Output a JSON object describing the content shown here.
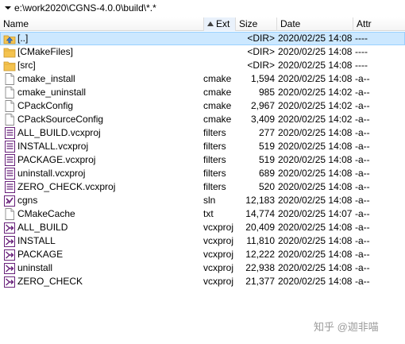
{
  "path_bar": {
    "path": "e:\\work2020\\CGNS-4.0.0\\build\\*.*",
    "dropdown_icon": "chevron-down-icon"
  },
  "columns": {
    "name": "Name",
    "ext": "Ext",
    "size": "Size",
    "date": "Date",
    "attr": "Attr",
    "sort_indicator": "sort-ascending-icon"
  },
  "rows": [
    {
      "name": "[..]",
      "ext": "",
      "size": "<DIR>",
      "date": "2020/02/25 14:08",
      "attr": "----",
      "icon": "up-dir"
    },
    {
      "name": "[CMakeFiles]",
      "ext": "",
      "size": "<DIR>",
      "date": "2020/02/25 14:08",
      "attr": "----",
      "icon": "folder"
    },
    {
      "name": "[src]",
      "ext": "",
      "size": "<DIR>",
      "date": "2020/02/25 14:08",
      "attr": "----",
      "icon": "folder"
    },
    {
      "name": "cmake_install",
      "ext": "cmake",
      "size": "1,594",
      "date": "2020/02/25 14:08",
      "attr": "-a--",
      "icon": "file"
    },
    {
      "name": "cmake_uninstall",
      "ext": "cmake",
      "size": "985",
      "date": "2020/02/25 14:02",
      "attr": "-a--",
      "icon": "file"
    },
    {
      "name": "CPackConfig",
      "ext": "cmake",
      "size": "2,967",
      "date": "2020/02/25 14:02",
      "attr": "-a--",
      "icon": "file"
    },
    {
      "name": "CPackSourceConfig",
      "ext": "cmake",
      "size": "3,409",
      "date": "2020/02/25 14:02",
      "attr": "-a--",
      "icon": "file"
    },
    {
      "name": "ALL_BUILD.vcxproj",
      "ext": "filters",
      "size": "277",
      "date": "2020/02/25 14:08",
      "attr": "-a--",
      "icon": "filters"
    },
    {
      "name": "INSTALL.vcxproj",
      "ext": "filters",
      "size": "519",
      "date": "2020/02/25 14:08",
      "attr": "-a--",
      "icon": "filters"
    },
    {
      "name": "PACKAGE.vcxproj",
      "ext": "filters",
      "size": "519",
      "date": "2020/02/25 14:08",
      "attr": "-a--",
      "icon": "filters"
    },
    {
      "name": "uninstall.vcxproj",
      "ext": "filters",
      "size": "689",
      "date": "2020/02/25 14:08",
      "attr": "-a--",
      "icon": "filters"
    },
    {
      "name": "ZERO_CHECK.vcxproj",
      "ext": "filters",
      "size": "520",
      "date": "2020/02/25 14:08",
      "attr": "-a--",
      "icon": "filters"
    },
    {
      "name": "cgns",
      "ext": "sln",
      "size": "12,183",
      "date": "2020/02/25 14:08",
      "attr": "-a--",
      "icon": "sln"
    },
    {
      "name": "CMakeCache",
      "ext": "txt",
      "size": "14,774",
      "date": "2020/02/25 14:07",
      "attr": "-a--",
      "icon": "file"
    },
    {
      "name": "ALL_BUILD",
      "ext": "vcxproj",
      "size": "20,409",
      "date": "2020/02/25 14:08",
      "attr": "-a--",
      "icon": "vcxproj"
    },
    {
      "name": "INSTALL",
      "ext": "vcxproj",
      "size": "11,810",
      "date": "2020/02/25 14:08",
      "attr": "-a--",
      "icon": "vcxproj"
    },
    {
      "name": "PACKAGE",
      "ext": "vcxproj",
      "size": "12,222",
      "date": "2020/02/25 14:08",
      "attr": "-a--",
      "icon": "vcxproj"
    },
    {
      "name": "uninstall",
      "ext": "vcxproj",
      "size": "22,938",
      "date": "2020/02/25 14:08",
      "attr": "-a--",
      "icon": "vcxproj"
    },
    {
      "name": "ZERO_CHECK",
      "ext": "vcxproj",
      "size": "21,377",
      "date": "2020/02/25 14:08",
      "attr": "-a--",
      "icon": "vcxproj"
    }
  ],
  "selected_row": 0,
  "watermark": {
    "text": "知乎 @迦非喵"
  },
  "colors": {
    "selection": "#cce8ff",
    "folder": "#f4c34f",
    "vcxproj": "#68217a"
  }
}
